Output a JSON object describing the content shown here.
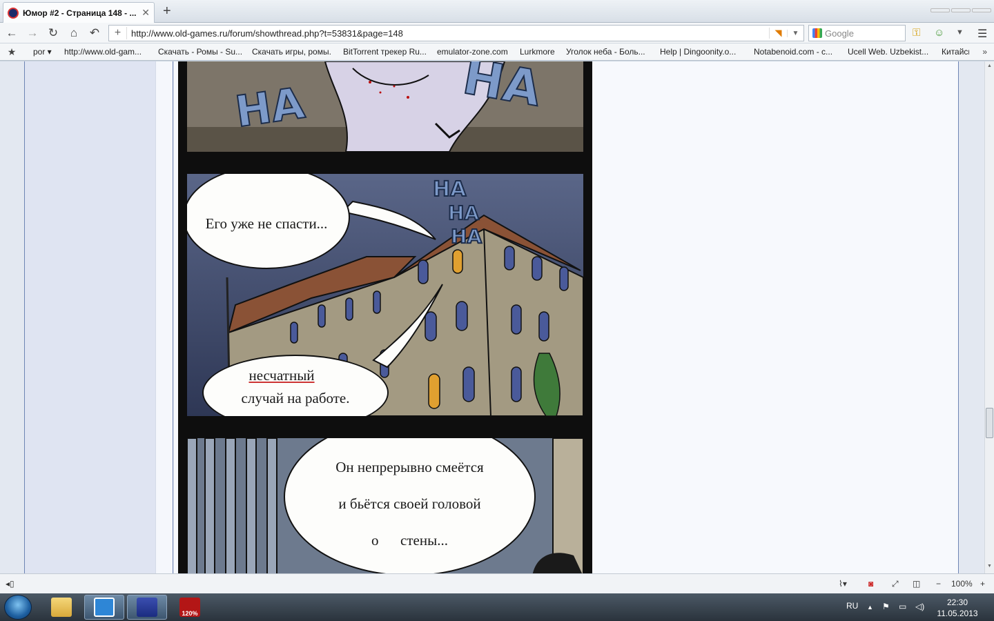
{
  "tab": {
    "title": "Юмор #2 - Страница 148 - ...",
    "close": "✕",
    "new_tab": "+"
  },
  "nav": {
    "url": "http://www.old-games.ru/forum/showthread.php?t=53831&page=148",
    "search_placeholder": "Google",
    "icons": [
      "back-icon",
      "forward-icon",
      "reload-icon",
      "home-icon",
      "undo-icon",
      "add-icon",
      "rss-icon",
      "key-icon",
      "account-icon",
      "download-icon",
      "menu-icon"
    ]
  },
  "bookmarks": {
    "items": [
      "por ▾",
      "http://www.old-gam...",
      "Скачать - Ромы - Su...",
      "Скачать игры, ромы.",
      "BitTorrent трекер Ru...",
      "emulator-zone.com",
      "Lurkmore",
      "Уголок неба - Боль...",
      "Help | Dingoonity.o...",
      "Notabenoid.com - с...",
      "Ucell Web. Uzbekist...",
      "Китайскі"
    ],
    "more": "»"
  },
  "comic": {
    "panel1_sfx": [
      "HA",
      "HA"
    ],
    "panel2_sfx": [
      "HA",
      "HA",
      "HA"
    ],
    "bubble1": "Его уже не спасти...",
    "bubble2_line1": "несчатный",
    "bubble2_line2": "случай на работе.",
    "bubble3_line1": "Он непрерывно смеётся",
    "bubble3_line2": "и бьётся своей головой",
    "bubble3_line3": "о      стены..."
  },
  "statusbar": {
    "zoom": "100%",
    "minus": "−",
    "plus": "+"
  },
  "taskbar": {
    "lang": "RU",
    "time": "22:30",
    "date": "11.05.2013",
    "apps": [
      "windows-explorer",
      "maxthon-browser",
      "save-app",
      "acrobat-app"
    ],
    "acrobat_badge": "120%"
  }
}
